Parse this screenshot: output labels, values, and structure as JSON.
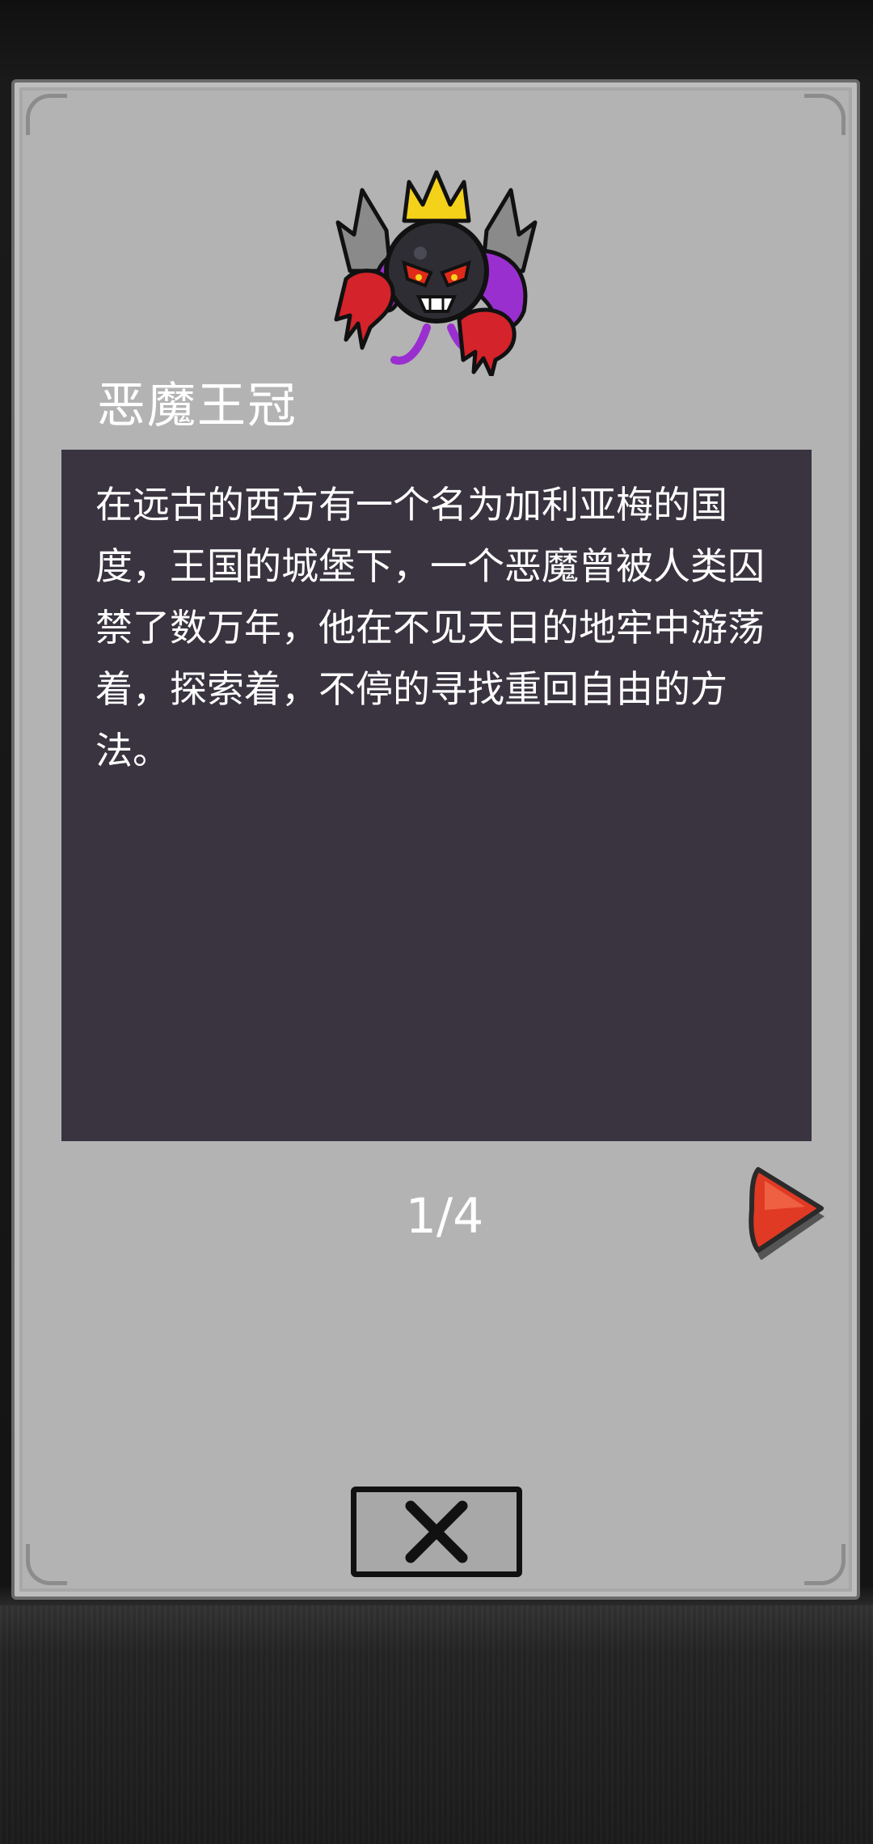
{
  "item": {
    "title": "恶魔王冠",
    "description": "在远古的西方有一个名为加利亚梅的国度，王国的城堡下，一个恶魔曾被人类囚禁了数万年，他在不见天日的地牢中游荡着，探索着，不停的寻找重回自由的方法。",
    "image_icon": "demon-crown-icon"
  },
  "pagination": {
    "label": "1/4",
    "current": 1,
    "total": 4
  },
  "controls": {
    "next_icon": "arrow-right-icon",
    "close_icon": "close-icon"
  },
  "colors": {
    "panel": "#b3b3b3",
    "description_bg": "#3a3440",
    "next_arrow": "#e03a24",
    "text": "#ffffff"
  }
}
